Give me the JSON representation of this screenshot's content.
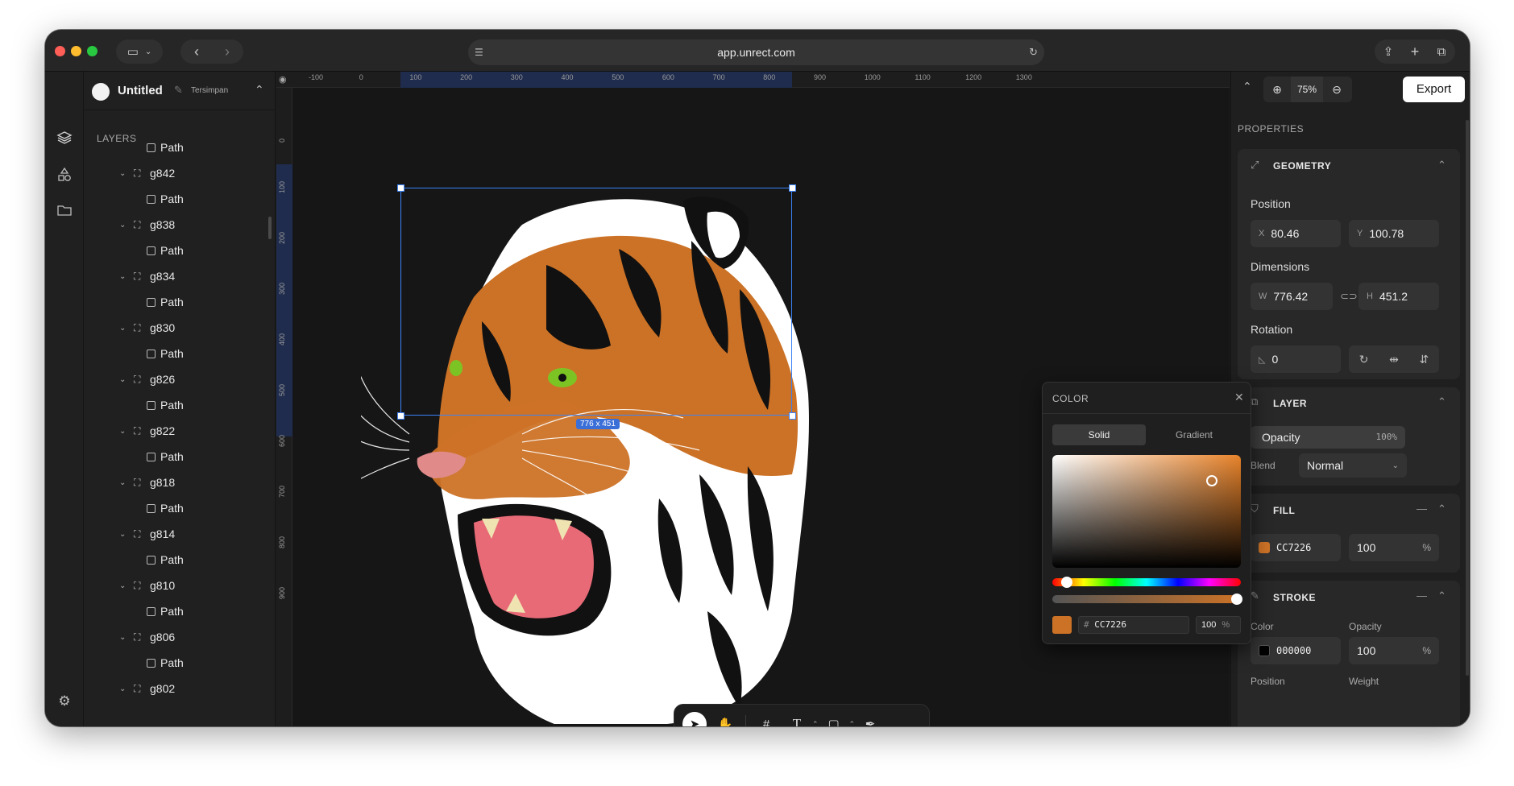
{
  "browser": {
    "url": "app.unrect.com",
    "colors": {
      "close": "#ff5f57",
      "minimize": "#febc2e",
      "zoom": "#28c840"
    }
  },
  "document": {
    "title": "Untitled",
    "status": "Tersimpan"
  },
  "layers": {
    "heading": "LAYERS",
    "items": [
      {
        "name": "Path",
        "type": "path"
      },
      {
        "name": "g842",
        "type": "group"
      },
      {
        "name": "Path",
        "type": "path"
      },
      {
        "name": "g838",
        "type": "group"
      },
      {
        "name": "Path",
        "type": "path"
      },
      {
        "name": "g834",
        "type": "group"
      },
      {
        "name": "Path",
        "type": "path"
      },
      {
        "name": "g830",
        "type": "group"
      },
      {
        "name": "Path",
        "type": "path"
      },
      {
        "name": "g826",
        "type": "group"
      },
      {
        "name": "Path",
        "type": "path"
      },
      {
        "name": "g822",
        "type": "group"
      },
      {
        "name": "Path",
        "type": "path"
      },
      {
        "name": "g818",
        "type": "group"
      },
      {
        "name": "Path",
        "type": "path"
      },
      {
        "name": "g814",
        "type": "group"
      },
      {
        "name": "Path",
        "type": "path"
      },
      {
        "name": "g810",
        "type": "group"
      },
      {
        "name": "Path",
        "type": "path"
      },
      {
        "name": "g806",
        "type": "group"
      },
      {
        "name": "Path",
        "type": "path"
      },
      {
        "name": "g802",
        "type": "group"
      }
    ]
  },
  "ruler": {
    "top": [
      "-100",
      "0",
      "100",
      "200",
      "300",
      "400",
      "500",
      "600",
      "700",
      "800",
      "900",
      "1000",
      "1100",
      "1200",
      "1300"
    ],
    "left": [
      "0",
      "100",
      "200",
      "300",
      "400",
      "500",
      "600",
      "700",
      "800",
      "900"
    ]
  },
  "canvas": {
    "selection_label": "776 x 451"
  },
  "zoom": {
    "level": "75%"
  },
  "export_label": "Export",
  "properties": {
    "heading": "PROPERTIES",
    "geometry": {
      "title": "GEOMETRY",
      "position_label": "Position",
      "x_label": "X",
      "x": "80.46",
      "y_label": "Y",
      "y": "100.78",
      "dimensions_label": "Dimensions",
      "w_label": "W",
      "w": "776.42",
      "h_label": "H",
      "h": "451.2",
      "rotation_label": "Rotation",
      "rotation": "0"
    },
    "layer": {
      "title": "LAYER",
      "opacity_label": "Opacity",
      "opacity": "100%",
      "blend_label": "Blend",
      "blend": "Normal"
    },
    "fill": {
      "title": "FILL",
      "hex": "CC7226",
      "color": "#CC7226",
      "opacity": "100",
      "unit": "%"
    },
    "stroke": {
      "title": "STROKE",
      "color_label": "Color",
      "opacity_label": "Opacity",
      "hex": "000000",
      "color": "#000000",
      "opacity": "100",
      "unit": "%",
      "position_label": "Position",
      "weight_label": "Weight"
    }
  },
  "color_picker": {
    "title": "COLOR",
    "tab_solid": "Solid",
    "tab_gradient": "Gradient",
    "hash": "#",
    "hex": "CC7226",
    "opacity": "100",
    "unit": "%"
  }
}
